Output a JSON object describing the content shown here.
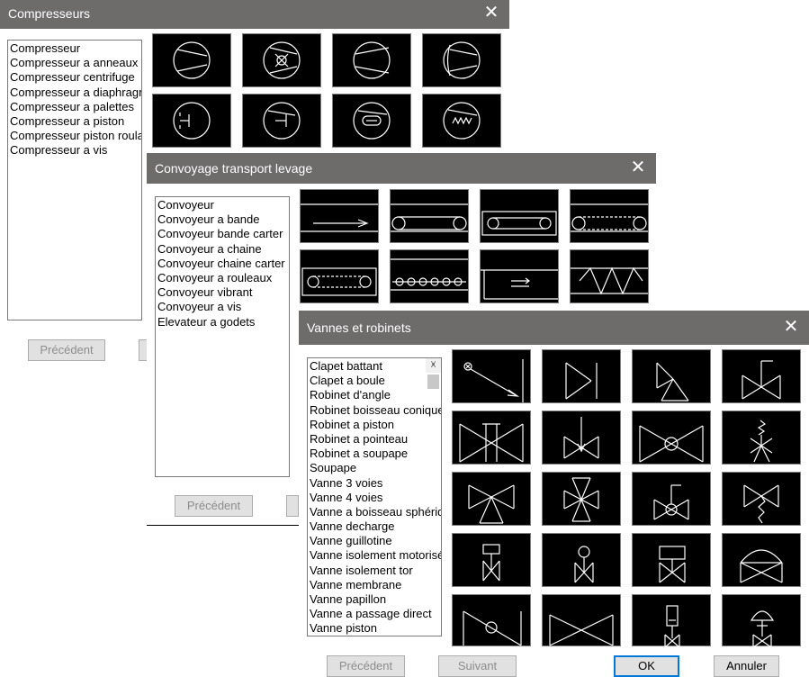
{
  "dialogs": {
    "compresseurs": {
      "title": "Compresseurs",
      "items": [
        "Compresseur",
        "Compresseur a anneaux",
        "Compresseur centrifuge",
        "Compresseur a diaphragme",
        "Compresseur a palettes",
        "Compresseur a piston",
        "Compresseur piston roulant",
        "Compresseur a vis"
      ],
      "prev_label": "Précédent"
    },
    "convoyage": {
      "title": "Convoyage transport levage",
      "items": [
        "Convoyeur",
        "Convoyeur a bande",
        "Convoyeur bande carter",
        "Convoyeur a chaine",
        "Convoyeur chaine carter",
        "Convoyeur a rouleaux",
        "Convoyeur vibrant",
        "Convoyeur a vis",
        "Elevateur a godets"
      ],
      "prev_label": "Précédent"
    },
    "vannes": {
      "title": "Vannes et robinets",
      "items": [
        "Clapet battant",
        "Clapet a boule",
        "Robinet d'angle",
        "Robinet boisseau conique",
        "Robinet a piston",
        "Robinet a pointeau",
        "Robinet a soupape",
        "Soupape",
        "Vanne 3 voies",
        "Vanne 4 voies",
        "Vanne a boisseau sphérique",
        "Vanne decharge",
        "Vanne guillotine",
        "Vanne isolement motorisée",
        "Vanne isolement tor",
        "Vanne membrane",
        "Vanne papillon",
        "Vanne a passage direct",
        "Vanne piston"
      ],
      "prev_label": "Précédent",
      "next_label": "Suivant",
      "ok_label": "OK",
      "cancel_label": "Annuler"
    }
  },
  "close_glyph": "✕",
  "scroll_up_glyph": "˄",
  "scroll_down_glyph": "˅"
}
